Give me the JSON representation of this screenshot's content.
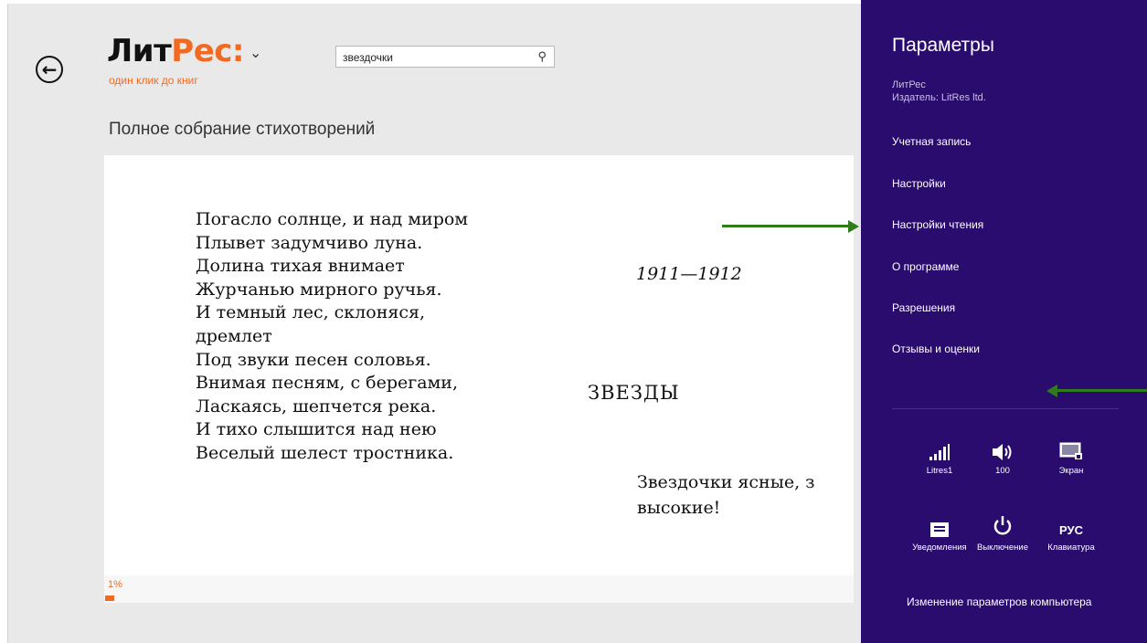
{
  "app": {
    "logo_main": "Лит",
    "logo_accent": "Рес:",
    "logo_chevron": "⌄",
    "tagline": "один клик до книг",
    "search_value": "звездочки",
    "book_title": "Полное собрание стихотворений"
  },
  "reader": {
    "poem_lines": [
      "Погасло солнце, и над миром",
      "Плывет задумчиво луна.",
      "Долина тихая внимает",
      "Журчанью мирного ручья.",
      "И темный лес, склоняся,",
      "дремлет",
      "Под звуки песен соловья.",
      "Внимая песням, с берегами,",
      "Ласкаясь, шепчется река.",
      "И тихо слышится над нею",
      "Веселый шелест тростника."
    ],
    "date": "1911—1912",
    "chapter_title": "ЗВЕЗДЫ",
    "next_lines": [
      "Звездочки ясные, з",
      "высокие!"
    ],
    "progress_label": "1%",
    "progress_value": 0.01
  },
  "charm": {
    "title": "Параметры",
    "app_name": "ЛитРес",
    "publisher": "Издатель: LitRes ltd.",
    "menu": [
      "Учетная запись",
      "Настройки",
      "Настройки чтения",
      "О программе",
      "Разрешения",
      "Отзывы и оценки"
    ],
    "quick": [
      {
        "label": "Litres1",
        "icon": "wifi-signal-icon"
      },
      {
        "label": "100",
        "icon": "volume-icon"
      },
      {
        "label": "Экран",
        "icon": "screen-brightness-icon"
      },
      {
        "label": "Уведомления",
        "icon": "notifications-icon"
      },
      {
        "label": "Выключение",
        "icon": "power-icon"
      },
      {
        "label": "Клавиатура",
        "icon": "keyboard-icon",
        "glyph": "РУС"
      }
    ],
    "pc_settings": "Изменение параметров компьютера"
  },
  "colors": {
    "accent": "#f26a21",
    "charm_bg": "#2a0b6e",
    "arrow": "#2e7d1a"
  }
}
